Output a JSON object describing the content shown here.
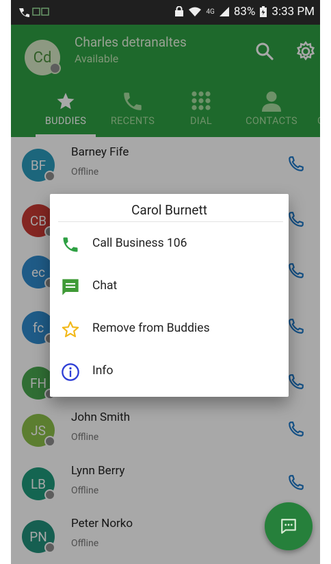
{
  "status_bar": {
    "battery": "83%",
    "time": "3:33 PM",
    "network": "4G"
  },
  "header": {
    "avatar_initials": "Cd",
    "user_name": "Charles detranaltes",
    "user_status": "Available"
  },
  "tabs": [
    {
      "label": "BUDDIES",
      "icon": "star-icon",
      "active": true
    },
    {
      "label": "RECENTS",
      "icon": "phone-icon"
    },
    {
      "label": "DIAL",
      "icon": "dialpad-icon"
    },
    {
      "label": "CONTACTS",
      "icon": "person-icon"
    },
    {
      "label": "G",
      "icon": ""
    }
  ],
  "buddies": [
    {
      "initials": "BF",
      "name": "Barney Fife",
      "status": "Offline",
      "color": "#2b9bbd"
    },
    {
      "initials": "CB",
      "name": "",
      "status": "",
      "color": "#c93a34"
    },
    {
      "initials": "ec",
      "name": "",
      "status": "",
      "color": "#2f8acd"
    },
    {
      "initials": "fc",
      "name": "",
      "status": "",
      "color": "#2f8acd"
    },
    {
      "initials": "FH",
      "name": "",
      "status": "",
      "color": "#4aa850"
    },
    {
      "initials": "JS",
      "name": "John Smith",
      "status": "Offline",
      "color": "#8cbf4a"
    },
    {
      "initials": "LB",
      "name": "Lynn Berry",
      "status": "Offline",
      "color": "#1f9a7c"
    },
    {
      "initials": "PN",
      "name": "Peter Norko",
      "status": "Offline",
      "color": "#22907b"
    }
  ],
  "dialog": {
    "title": "Carol Burnett",
    "items": [
      {
        "label": "Call Business 106",
        "icon": "phone-icon",
        "color": "#2ea043"
      },
      {
        "label": "Chat",
        "icon": "chat-icon",
        "color": "#3f9a36"
      },
      {
        "label": "Remove from Buddies",
        "icon": "star-outline-icon",
        "color": "#f2b818"
      },
      {
        "label": "Info",
        "icon": "info-icon",
        "color": "#2f3fd6"
      }
    ]
  },
  "colors": {
    "brand_green": "#2ea043",
    "call_blue": "#1e78c8"
  }
}
